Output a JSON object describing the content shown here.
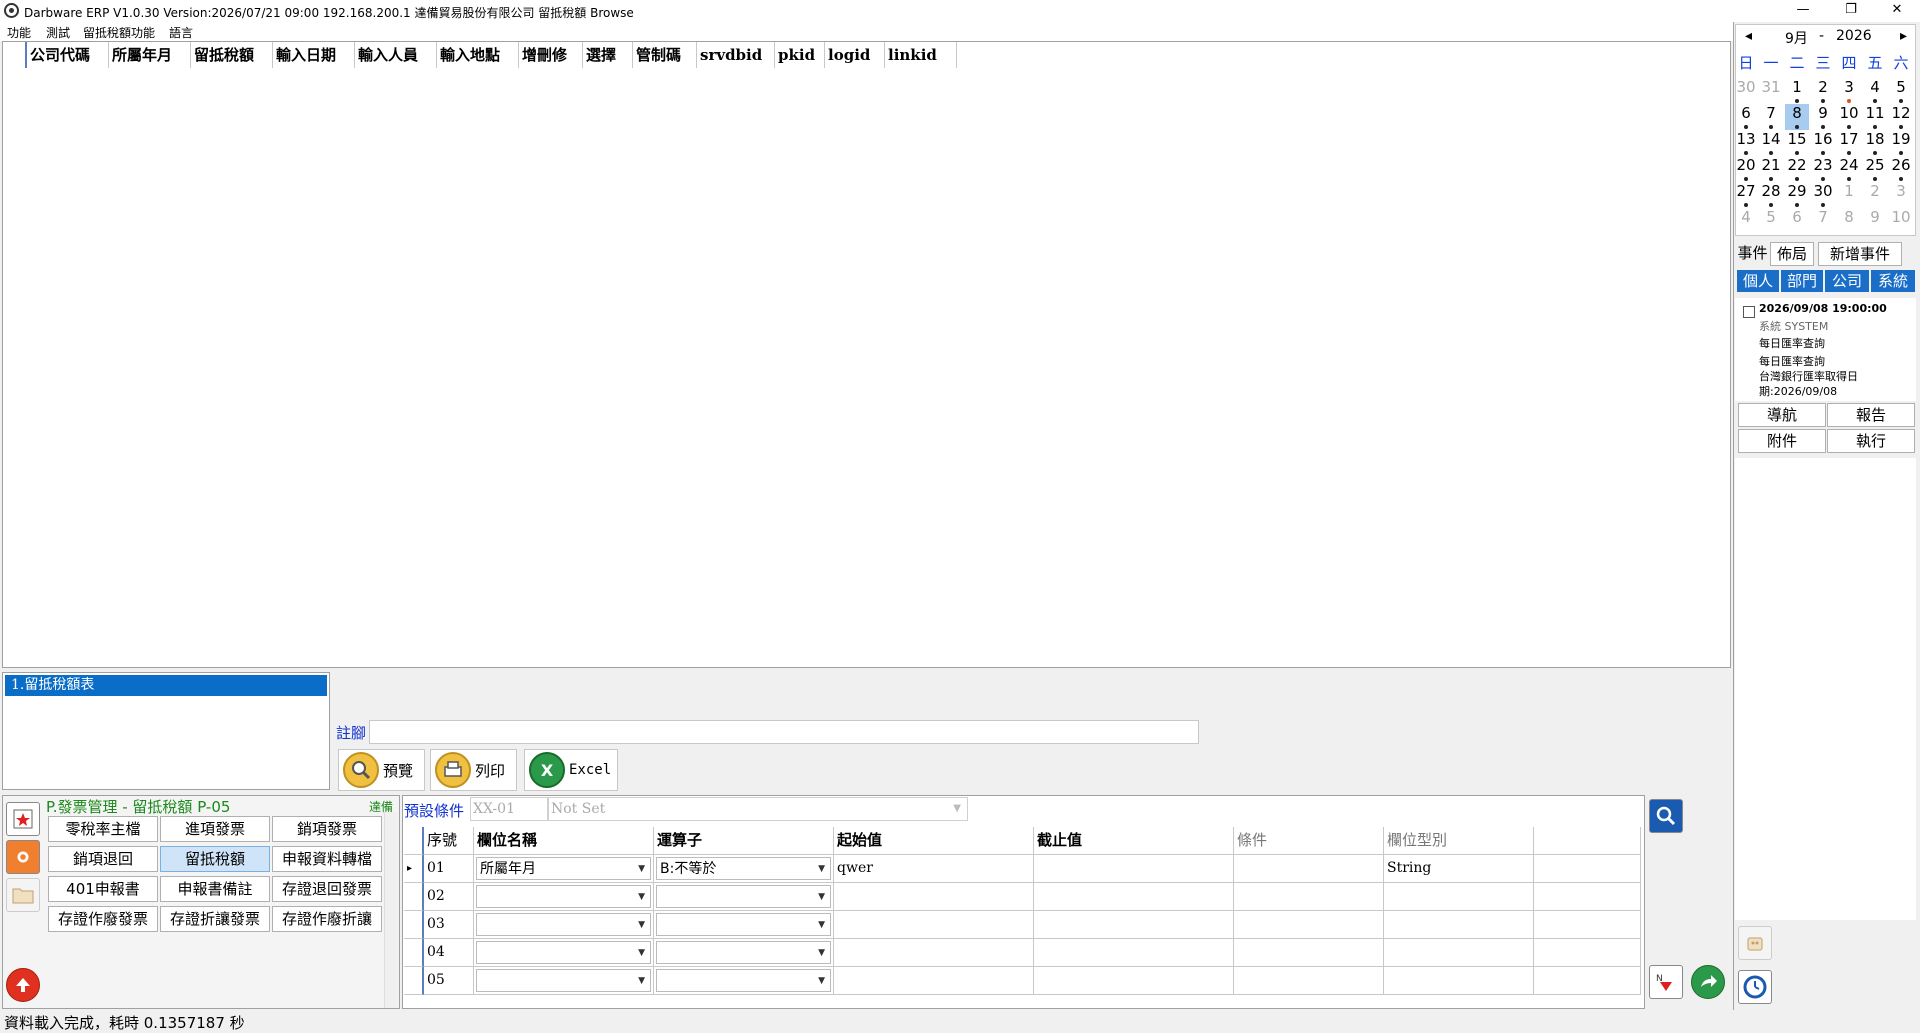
{
  "window": {
    "title": "Darbware ERP V1.0.30 Version:2026/07/21 09:00   192.168.200.1 達備貿易股份有限公司 留抵稅額 Browse",
    "min_glyph": "—",
    "max_glyph": "❐",
    "close_glyph": "✕"
  },
  "menu": [
    "功能",
    "測試",
    "留抵稅額功能",
    "語言"
  ],
  "grid": {
    "columns": [
      "公司代碼",
      "所屬年月",
      "留抵稅額",
      "輸入日期",
      "輸入人員",
      "輸入地點",
      "增刪修",
      "選擇",
      "管制碼",
      "srvdbid",
      "pkid",
      "logid",
      "linkid"
    ]
  },
  "reports": {
    "items": [
      "1.留抵稅額表"
    ]
  },
  "footnote": {
    "label": "註腳",
    "value": ""
  },
  "tools": {
    "preview": "預覽",
    "print": "列印",
    "excel": "Excel"
  },
  "module": {
    "title": "P.發票管理 - 留抵稅額  P-05",
    "corp": "達備",
    "buttons": [
      "零稅率主檔",
      "進項發票",
      "銷項發票",
      "銷項退回",
      "留抵稅額",
      "申報資料轉檔",
      "401申報書",
      "申報書備註",
      "存證退回發票",
      "存證作廢發票",
      "存證折讓發票",
      "存證作廢折讓"
    ],
    "active": "留抵稅額"
  },
  "conditions": {
    "label": "預設條件",
    "code": "XX-01",
    "name": "Not Set",
    "headers": [
      "序號",
      "欄位名稱",
      "運算子",
      "起始值",
      "截止值",
      "條件",
      "欄位型別"
    ],
    "rows": [
      {
        "seq": "01",
        "field": "所屬年月",
        "op": "B:不等於",
        "from": "qwer",
        "to": "",
        "cond": "",
        "type": "String",
        "current": "▸"
      },
      {
        "seq": "02",
        "field": "",
        "op": "",
        "from": "",
        "to": "",
        "cond": "",
        "type": "",
        "current": ""
      },
      {
        "seq": "03",
        "field": "",
        "op": "",
        "from": "",
        "to": "",
        "cond": "",
        "type": "",
        "current": ""
      },
      {
        "seq": "04",
        "field": "",
        "op": "",
        "from": "",
        "to": "",
        "cond": "",
        "type": "",
        "current": ""
      },
      {
        "seq": "05",
        "field": "",
        "op": "",
        "from": "",
        "to": "",
        "cond": "",
        "type": "",
        "current": ""
      }
    ]
  },
  "status": "資料載入完成，耗時 0.1357187 秒",
  "calendar": {
    "prev": "◂",
    "next": "▸",
    "month": "9月",
    "sep": "-",
    "year": "2026",
    "weekdays": [
      "日",
      "一",
      "二",
      "三",
      "四",
      "五",
      "六"
    ],
    "weeks": [
      [
        "30",
        "31",
        "1",
        "2",
        "3",
        "4",
        "5"
      ],
      [
        "6",
        "7",
        "8",
        "9",
        "10",
        "11",
        "12"
      ],
      [
        "13",
        "14",
        "15",
        "16",
        "17",
        "18",
        "19"
      ],
      [
        "20",
        "21",
        "22",
        "23",
        "24",
        "25",
        "26"
      ],
      [
        "27",
        "28",
        "29",
        "30",
        "1",
        "2",
        "3"
      ],
      [
        "4",
        "5",
        "6",
        "7",
        "8",
        "9",
        "10"
      ]
    ],
    "selected_day": "8",
    "tabs": {
      "event": "事件",
      "layout": "佈局",
      "new_event": "新增事件"
    },
    "categories": [
      "個人",
      "部門",
      "公司",
      "系統"
    ],
    "event": {
      "datetime": "2026/09/08 19:00:00",
      "owner": "系統  SYSTEM",
      "line1": "每日匯率查詢",
      "line2": "每日匯率查詢",
      "line3": "台灣銀行匯率取得日",
      "line4": "期:2026/09/08"
    },
    "actions": [
      "導航",
      "報告",
      "附件",
      "執行"
    ]
  },
  "colors": {
    "accent": "#1a6ec8",
    "selection": "#0a6ec8",
    "module_title": "#1a8a1a",
    "label_blue": "#1030d0"
  }
}
